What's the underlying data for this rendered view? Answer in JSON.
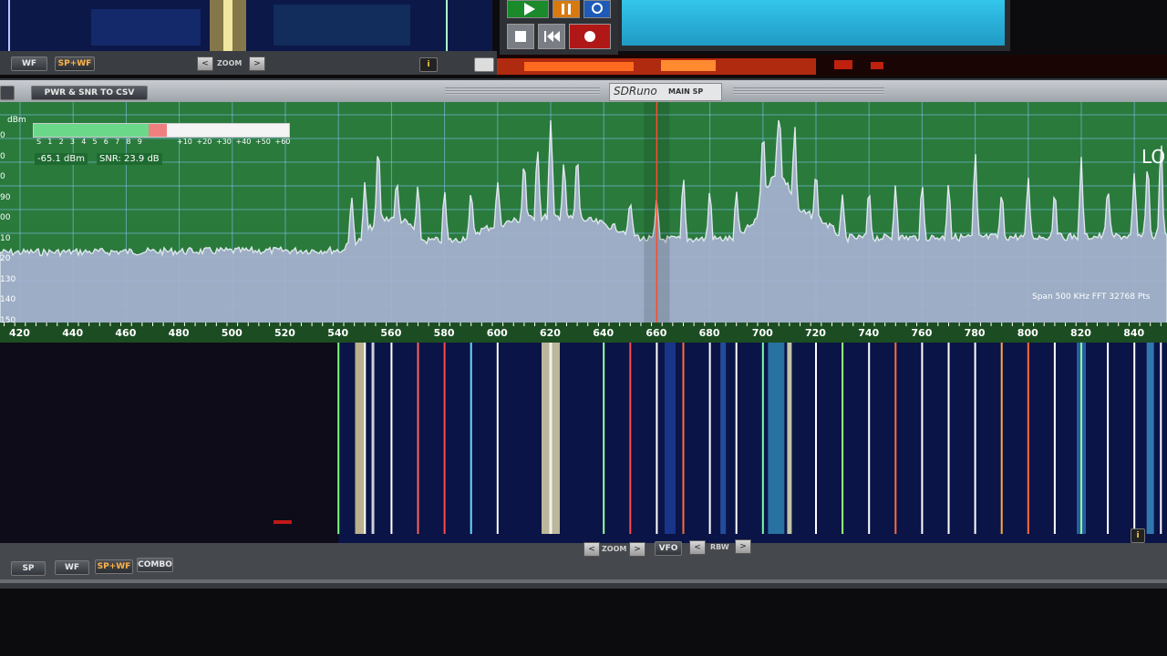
{
  "top_panel": {
    "wf_label": "WF",
    "spwf_label": "SP+WF",
    "zoom_label": "ZOOM",
    "left_arrow": "<",
    "right_arrow": ">",
    "info_label": "i"
  },
  "transport": {
    "play_icon": "play-icon",
    "pause_icon": "pause-icon",
    "loop_icon": "loop-icon",
    "stop_icon": "stop-icon",
    "rewind_icon": "rewind-icon",
    "record_icon": "record-icon"
  },
  "window": {
    "title_logo": "SDRuno",
    "title": "MAIN SP",
    "csv_button": "PWR & SNR TO CSV"
  },
  "smeter": {
    "scale": [
      "S",
      "1",
      "2",
      "3",
      "4",
      "5",
      "6",
      "7",
      "8",
      "9",
      "+10",
      "+20",
      "+30",
      "+40",
      "+50",
      "+60"
    ],
    "level_fraction": 0.45,
    "over_fraction": 0.07,
    "power": "-65.1 dBm",
    "snr": "SNR: 23.9 dB",
    "unit": "dBm"
  },
  "spectrum": {
    "y_labels": [
      "0",
      "0",
      "0",
      "90",
      "00",
      "10",
      "20",
      "130",
      "140",
      "150"
    ],
    "lo_label": "LO",
    "info": "Span 500 KHz  FFT 32768 Pts",
    "freq_ticks": [
      "420",
      "440",
      "460",
      "480",
      "500",
      "520",
      "540",
      "560",
      "580",
      "600",
      "620",
      "640",
      "660",
      "680",
      "700",
      "720",
      "740",
      "760",
      "780",
      "800",
      "820",
      "840"
    ],
    "colors": {
      "grid_bg": "#2a7a3c",
      "fill": "#a9b3d4",
      "cursor": "#ff4a2a"
    }
  },
  "bottom_bar": {
    "sp_label": "SP",
    "wf_label": "WF",
    "spwf_label": "SP+WF",
    "combo_label": "COMBO",
    "zoom_label": "ZOOM",
    "vfo_label": "VFO",
    "rbw_label": "RBW",
    "left_arrow": "<",
    "right_arrow": ">",
    "info_label": "i"
  }
}
